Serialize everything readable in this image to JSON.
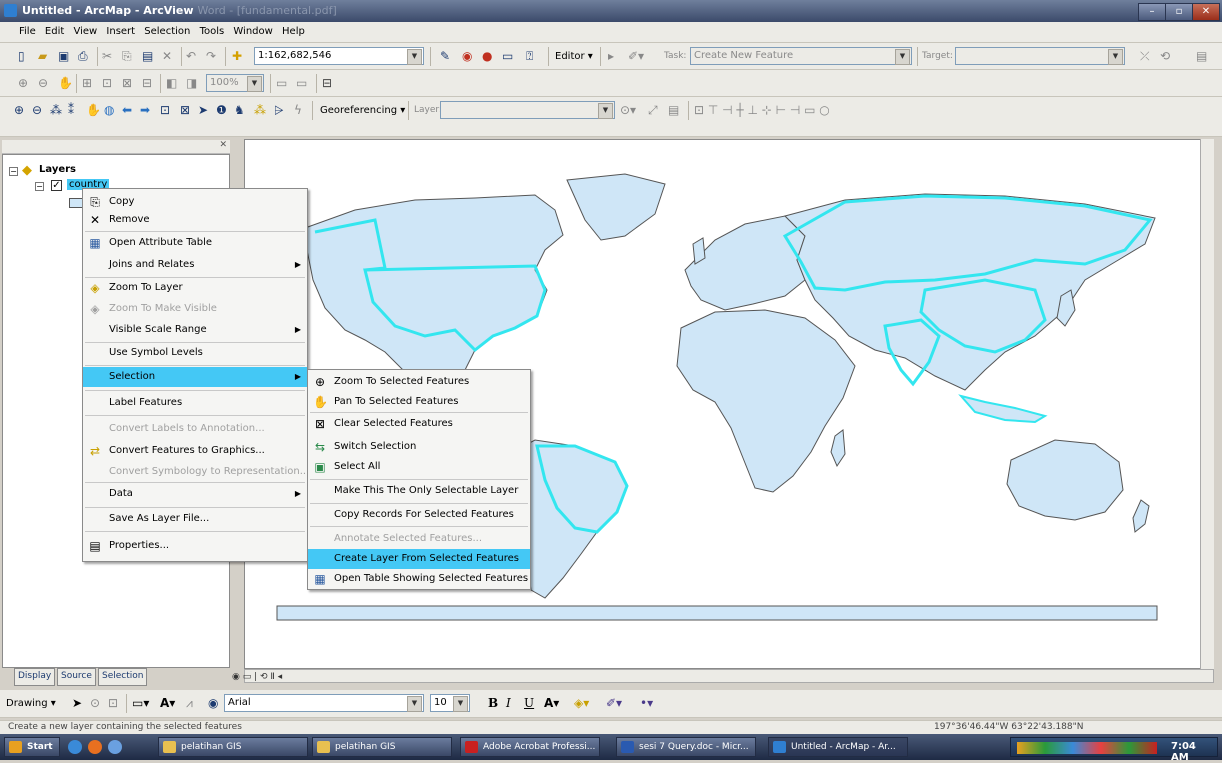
{
  "window": {
    "title": "Untitled - ArcMap - ArcView",
    "ghost_title": "Word - [fundamental.pdf]",
    "min": "–",
    "max": "▫",
    "close": "✕"
  },
  "menubar": [
    "File",
    "Edit",
    "View",
    "Insert",
    "Selection",
    "Tools",
    "Window",
    "Help"
  ],
  "toolbar_standard": {
    "scale": "1:162,682,546",
    "editor_label": "Editor ▾",
    "task_label": "Task:",
    "task_value": "Create New Feature",
    "target_label": "Target:",
    "target_value": ""
  },
  "toolbar_layout": {
    "zoom_percent": "100%"
  },
  "toolbar_tools": {
    "georef_label": "Georeferencing ▾",
    "layer_label": "Layer:",
    "layer_value": ""
  },
  "toc": {
    "root": "Layers",
    "layer": "country"
  },
  "toc_tabs": [
    "Display",
    "Source",
    "Selection"
  ],
  "context_menu": [
    {
      "label": "Copy",
      "icon": "copy-icon",
      "glyph": "⎘"
    },
    {
      "label": "Remove",
      "icon": "remove-icon",
      "glyph": "✕"
    },
    {
      "label": "Open Attribute Table",
      "icon": "table-icon",
      "glyph": "▦"
    },
    {
      "label": "Joins and Relates",
      "submenu": true
    },
    {
      "label": "Zoom To Layer",
      "icon": "zoom-layer-icon",
      "glyph": "◈"
    },
    {
      "label": "Zoom To Make Visible",
      "icon": "zoom-visible-icon",
      "glyph": "◈",
      "disabled": true
    },
    {
      "label": "Visible Scale Range",
      "submenu": true
    },
    {
      "label": "Use Symbol Levels"
    },
    {
      "label": "Selection",
      "submenu": true,
      "highlighted": true
    },
    {
      "label": "Label Features"
    },
    {
      "label": "Convert Labels to Annotation...",
      "disabled": true
    },
    {
      "label": "Convert Features to Graphics...",
      "icon": "convert-icon",
      "glyph": "⇄"
    },
    {
      "label": "Convert Symbology to Representation...",
      "disabled": true
    },
    {
      "label": "Data",
      "submenu": true
    },
    {
      "label": "Save As Layer File..."
    },
    {
      "label": "Properties...",
      "icon": "properties-icon",
      "glyph": "▤"
    }
  ],
  "selection_submenu": [
    {
      "label": "Zoom To Selected Features",
      "icon": "zoom-selected-icon",
      "glyph": "⊕"
    },
    {
      "label": "Pan To Selected Features",
      "icon": "pan-selected-icon",
      "glyph": "✋"
    },
    {
      "label": "Clear Selected Features",
      "icon": "clear-selected-icon",
      "glyph": "⊠"
    },
    {
      "label": "Switch Selection",
      "icon": "switch-selection-icon",
      "glyph": "⇆"
    },
    {
      "label": "Select All",
      "icon": "select-all-icon",
      "glyph": "▣"
    },
    {
      "label": "Make This The Only Selectable Layer"
    },
    {
      "label": "Copy Records For Selected Features"
    },
    {
      "label": "Annotate Selected Features...",
      "disabled": true
    },
    {
      "label": "Create Layer From Selected Features",
      "highlighted": true
    },
    {
      "label": "Open Table Showing Selected Features",
      "icon": "open-table-icon",
      "glyph": "▦"
    }
  ],
  "drawing_toolbar": {
    "drawing_label": "Drawing ▾",
    "font": "Arial",
    "size": "10",
    "bold": "B",
    "italic": "I",
    "underline": "U",
    "font_color": "A"
  },
  "status": {
    "message": "Create a new layer containing the selected features",
    "coords": "197°36'46.44\"W  63°22'43.188\"N"
  },
  "taskbar": {
    "start": "Start",
    "tasks": [
      "pelatihan GIS",
      "pelatihan GIS",
      "Adobe Acrobat Professi...",
      "sesi 7 Query.doc - Micr...",
      "Untitled - ArcMap - Ar..."
    ],
    "clock": "7:04 AM"
  },
  "colors": {
    "land": "#cfe6f7",
    "selection": "#33e6ef",
    "highlight": "#44c8f5"
  }
}
